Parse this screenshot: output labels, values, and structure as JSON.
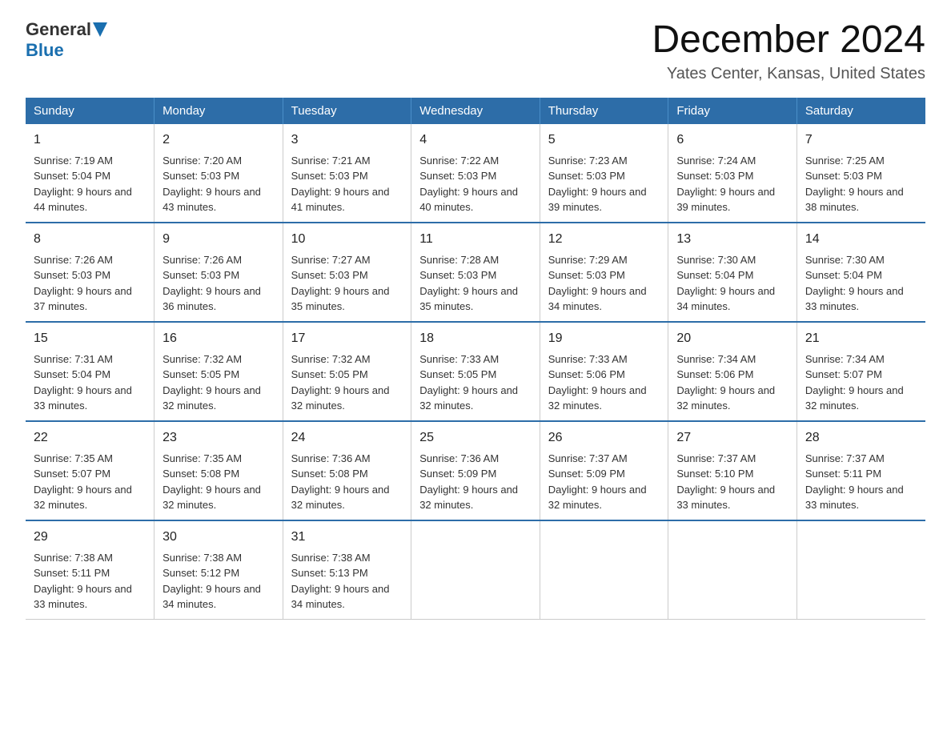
{
  "header": {
    "logo_general": "General",
    "logo_blue": "Blue",
    "month": "December 2024",
    "location": "Yates Center, Kansas, United States"
  },
  "days_of_week": [
    "Sunday",
    "Monday",
    "Tuesday",
    "Wednesday",
    "Thursday",
    "Friday",
    "Saturday"
  ],
  "weeks": [
    [
      {
        "day": "1",
        "sunrise": "7:19 AM",
        "sunset": "5:04 PM",
        "daylight": "9 hours and 44 minutes."
      },
      {
        "day": "2",
        "sunrise": "7:20 AM",
        "sunset": "5:03 PM",
        "daylight": "9 hours and 43 minutes."
      },
      {
        "day": "3",
        "sunrise": "7:21 AM",
        "sunset": "5:03 PM",
        "daylight": "9 hours and 41 minutes."
      },
      {
        "day": "4",
        "sunrise": "7:22 AM",
        "sunset": "5:03 PM",
        "daylight": "9 hours and 40 minutes."
      },
      {
        "day": "5",
        "sunrise": "7:23 AM",
        "sunset": "5:03 PM",
        "daylight": "9 hours and 39 minutes."
      },
      {
        "day": "6",
        "sunrise": "7:24 AM",
        "sunset": "5:03 PM",
        "daylight": "9 hours and 39 minutes."
      },
      {
        "day": "7",
        "sunrise": "7:25 AM",
        "sunset": "5:03 PM",
        "daylight": "9 hours and 38 minutes."
      }
    ],
    [
      {
        "day": "8",
        "sunrise": "7:26 AM",
        "sunset": "5:03 PM",
        "daylight": "9 hours and 37 minutes."
      },
      {
        "day": "9",
        "sunrise": "7:26 AM",
        "sunset": "5:03 PM",
        "daylight": "9 hours and 36 minutes."
      },
      {
        "day": "10",
        "sunrise": "7:27 AM",
        "sunset": "5:03 PM",
        "daylight": "9 hours and 35 minutes."
      },
      {
        "day": "11",
        "sunrise": "7:28 AM",
        "sunset": "5:03 PM",
        "daylight": "9 hours and 35 minutes."
      },
      {
        "day": "12",
        "sunrise": "7:29 AM",
        "sunset": "5:03 PM",
        "daylight": "9 hours and 34 minutes."
      },
      {
        "day": "13",
        "sunrise": "7:30 AM",
        "sunset": "5:04 PM",
        "daylight": "9 hours and 34 minutes."
      },
      {
        "day": "14",
        "sunrise": "7:30 AM",
        "sunset": "5:04 PM",
        "daylight": "9 hours and 33 minutes."
      }
    ],
    [
      {
        "day": "15",
        "sunrise": "7:31 AM",
        "sunset": "5:04 PM",
        "daylight": "9 hours and 33 minutes."
      },
      {
        "day": "16",
        "sunrise": "7:32 AM",
        "sunset": "5:05 PM",
        "daylight": "9 hours and 32 minutes."
      },
      {
        "day": "17",
        "sunrise": "7:32 AM",
        "sunset": "5:05 PM",
        "daylight": "9 hours and 32 minutes."
      },
      {
        "day": "18",
        "sunrise": "7:33 AM",
        "sunset": "5:05 PM",
        "daylight": "9 hours and 32 minutes."
      },
      {
        "day": "19",
        "sunrise": "7:33 AM",
        "sunset": "5:06 PM",
        "daylight": "9 hours and 32 minutes."
      },
      {
        "day": "20",
        "sunrise": "7:34 AM",
        "sunset": "5:06 PM",
        "daylight": "9 hours and 32 minutes."
      },
      {
        "day": "21",
        "sunrise": "7:34 AM",
        "sunset": "5:07 PM",
        "daylight": "9 hours and 32 minutes."
      }
    ],
    [
      {
        "day": "22",
        "sunrise": "7:35 AM",
        "sunset": "5:07 PM",
        "daylight": "9 hours and 32 minutes."
      },
      {
        "day": "23",
        "sunrise": "7:35 AM",
        "sunset": "5:08 PM",
        "daylight": "9 hours and 32 minutes."
      },
      {
        "day": "24",
        "sunrise": "7:36 AM",
        "sunset": "5:08 PM",
        "daylight": "9 hours and 32 minutes."
      },
      {
        "day": "25",
        "sunrise": "7:36 AM",
        "sunset": "5:09 PM",
        "daylight": "9 hours and 32 minutes."
      },
      {
        "day": "26",
        "sunrise": "7:37 AM",
        "sunset": "5:09 PM",
        "daylight": "9 hours and 32 minutes."
      },
      {
        "day": "27",
        "sunrise": "7:37 AM",
        "sunset": "5:10 PM",
        "daylight": "9 hours and 33 minutes."
      },
      {
        "day": "28",
        "sunrise": "7:37 AM",
        "sunset": "5:11 PM",
        "daylight": "9 hours and 33 minutes."
      }
    ],
    [
      {
        "day": "29",
        "sunrise": "7:38 AM",
        "sunset": "5:11 PM",
        "daylight": "9 hours and 33 minutes."
      },
      {
        "day": "30",
        "sunrise": "7:38 AM",
        "sunset": "5:12 PM",
        "daylight": "9 hours and 34 minutes."
      },
      {
        "day": "31",
        "sunrise": "7:38 AM",
        "sunset": "5:13 PM",
        "daylight": "9 hours and 34 minutes."
      },
      null,
      null,
      null,
      null
    ]
  ],
  "labels": {
    "sunrise_prefix": "Sunrise: ",
    "sunset_prefix": "Sunset: ",
    "daylight_prefix": "Daylight: "
  }
}
